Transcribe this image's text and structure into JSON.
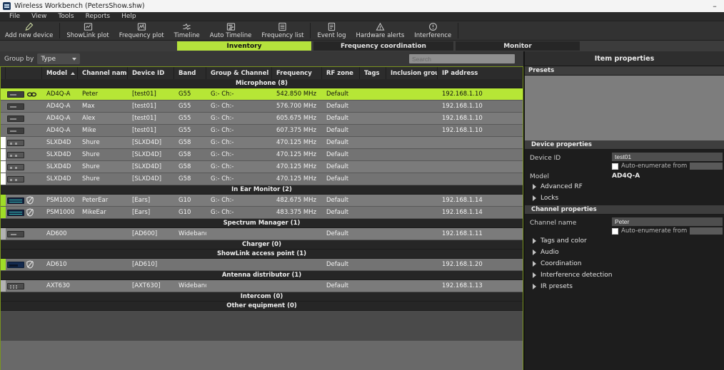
{
  "window": {
    "title": "Wireless Workbench (PetersShow.shw)",
    "minimize_glyph": "–"
  },
  "menu": {
    "items": [
      "File",
      "View",
      "Tools",
      "Reports",
      "Help"
    ]
  },
  "toolbar": {
    "group1": [
      {
        "label": "Add new device",
        "icon": "microphone-pencil-icon"
      }
    ],
    "group2": [
      {
        "label": "ShowLink plot",
        "icon": "showlink-plot-icon"
      },
      {
        "label": "Frequency plot",
        "icon": "frequency-plot-icon"
      },
      {
        "label": "Timeline",
        "icon": "timeline-icon"
      },
      {
        "label": "Auto Timeline",
        "icon": "auto-timeline-icon"
      },
      {
        "label": "Frequency list",
        "icon": "frequency-list-icon"
      }
    ],
    "group3": [
      {
        "label": "Event log",
        "icon": "event-log-icon"
      },
      {
        "label": "Hardware alerts",
        "icon": "warning-triangle-icon"
      },
      {
        "label": "Interference",
        "icon": "interference-circle-icon"
      }
    ]
  },
  "tabs": {
    "inventory": "Inventory",
    "frequency_coordination": "Frequency coordination",
    "monitor": "Monitor"
  },
  "filter": {
    "group_by_label": "Group by",
    "group_by_value": "Type",
    "search_placeholder": "Search"
  },
  "table": {
    "headers": {
      "model": "Model",
      "channel": "Channel name",
      "device_id": "Device ID",
      "band": "Band",
      "group_channel": "Group & Channel",
      "frequency": "Frequency",
      "rf_zone": "RF zone",
      "tags": "Tags",
      "inclusion": "Inclusion group",
      "ip": "IP address"
    },
    "rows": [
      {
        "type": "group",
        "label": "Microphone (8)"
      },
      {
        "type": "device",
        "selected": true,
        "indicator": "none",
        "kind": "ad4q",
        "badge": "link",
        "model": "AD4Q-A",
        "channel": "Peter",
        "device_id": "[test01]",
        "band": "G55",
        "group_channel": "G:- Ch:-",
        "frequency": "542.850 MHz",
        "rf_zone": "Default",
        "tags": "",
        "inclusion": "",
        "ip": "192.168.1.10"
      },
      {
        "type": "device",
        "indicator": "none",
        "kind": "ad4q",
        "badge": "",
        "model": "AD4Q-A",
        "channel": "Max",
        "device_id": "[test01]",
        "band": "G55",
        "group_channel": "G:- Ch:-",
        "frequency": "576.700 MHz",
        "rf_zone": "Default",
        "tags": "",
        "inclusion": "",
        "ip": "192.168.1.10"
      },
      {
        "type": "device",
        "indicator": "none",
        "kind": "ad4q",
        "badge": "",
        "model": "AD4Q-A",
        "channel": "Alex",
        "device_id": "[test01]",
        "band": "G55",
        "group_channel": "G:- Ch:-",
        "frequency": "605.675 MHz",
        "rf_zone": "Default",
        "tags": "",
        "inclusion": "",
        "ip": "192.168.1.10"
      },
      {
        "type": "device",
        "indicator": "none",
        "kind": "ad4q",
        "badge": "",
        "model": "AD4Q-A",
        "channel": "Mike",
        "device_id": "[test01]",
        "band": "G55",
        "group_channel": "G:- Ch:-",
        "frequency": "607.375 MHz",
        "rf_zone": "Default",
        "tags": "",
        "inclusion": "",
        "ip": "192.168.1.10"
      },
      {
        "type": "device",
        "indicator": "white",
        "kind": "slxd",
        "badge": "",
        "model": "SLXD4D",
        "channel": "Shure",
        "device_id": "[SLXD4D]",
        "band": "G58",
        "group_channel": "G:- Ch:-",
        "frequency": "470.125 MHz",
        "rf_zone": "Default",
        "tags": "",
        "inclusion": "",
        "ip": ""
      },
      {
        "type": "device",
        "indicator": "white",
        "kind": "slxd",
        "badge": "",
        "model": "SLXD4D",
        "channel": "Shure",
        "device_id": "[SLXD4D]",
        "band": "G58",
        "group_channel": "G:- Ch:-",
        "frequency": "470.125 MHz",
        "rf_zone": "Default",
        "tags": "",
        "inclusion": "",
        "ip": ""
      },
      {
        "type": "device",
        "indicator": "white",
        "kind": "slxd",
        "badge": "",
        "model": "SLXD4D",
        "channel": "Shure",
        "device_id": "[SLXD4D]",
        "band": "G58",
        "group_channel": "G:- Ch:-",
        "frequency": "470.125 MHz",
        "rf_zone": "Default",
        "tags": "",
        "inclusion": "",
        "ip": ""
      },
      {
        "type": "device",
        "indicator": "white",
        "kind": "slxd",
        "badge": "",
        "model": "SLXD4D",
        "channel": "Shure",
        "device_id": "[SLXD4D]",
        "band": "G58",
        "group_channel": "G:- Ch:-",
        "frequency": "470.125 MHz",
        "rf_zone": "Default",
        "tags": "",
        "inclusion": "",
        "ip": ""
      },
      {
        "type": "group",
        "label": "In Ear Monitor (2)"
      },
      {
        "type": "device",
        "indicator": "green",
        "kind": "psm",
        "badge": "shield",
        "model": "PSM1000",
        "channel": "PeterEar",
        "device_id": "[Ears]",
        "band": "G10",
        "group_channel": "G:- Ch:-",
        "frequency": "482.675 MHz",
        "rf_zone": "Default",
        "tags": "",
        "inclusion": "",
        "ip": "192.168.1.14"
      },
      {
        "type": "device",
        "indicator": "green",
        "kind": "psm",
        "badge": "shield",
        "model": "PSM1000",
        "channel": "MikeEar",
        "device_id": "[Ears]",
        "band": "G10",
        "group_channel": "G:- Ch:-",
        "frequency": "483.375 MHz",
        "rf_zone": "Default",
        "tags": "",
        "inclusion": "",
        "ip": "192.168.1.14"
      },
      {
        "type": "group",
        "label": "Spectrum Manager (1)"
      },
      {
        "type": "device",
        "indicator": "light",
        "kind": "ad600",
        "badge": "",
        "model": "AD600",
        "channel": "",
        "device_id": "[AD600]",
        "band": "Wideband",
        "group_channel": "",
        "frequency": "",
        "rf_zone": "Default",
        "tags": "",
        "inclusion": "",
        "ip": "192.168.1.11"
      },
      {
        "type": "group",
        "label": "Charger (0)"
      },
      {
        "type": "group",
        "label": "ShowLink access point (1)"
      },
      {
        "type": "device",
        "indicator": "green",
        "kind": "ad610",
        "badge": "shield",
        "model": "AD610",
        "channel": "",
        "device_id": "[AD610]",
        "band": "",
        "group_channel": "",
        "frequency": "",
        "rf_zone": "Default",
        "tags": "",
        "inclusion": "",
        "ip": "192.168.1.20"
      },
      {
        "type": "group",
        "label": "Antenna distributor (1)"
      },
      {
        "type": "device",
        "indicator": "light",
        "kind": "axt",
        "badge": "",
        "model": "AXT630",
        "channel": "",
        "device_id": "[AXT630]",
        "band": "Wideband",
        "group_channel": "",
        "frequency": "",
        "rf_zone": "Default",
        "tags": "",
        "inclusion": "",
        "ip": "192.168.1.13"
      },
      {
        "type": "group",
        "label": "Intercom (0)"
      },
      {
        "type": "group",
        "label": "Other equipment (0)"
      }
    ]
  },
  "panel": {
    "title": "Item properties",
    "presets_title": "Presets",
    "device_properties": {
      "title": "Device properties",
      "device_id_label": "Device ID",
      "device_id_value": "test01",
      "auto_enumerate_label": "Auto-enumerate from",
      "model_label": "Model",
      "model_value": "AD4Q-A",
      "collapsed": {
        "0": "Advanced RF",
        "1": "Locks"
      }
    },
    "channel_properties": {
      "title": "Channel properties",
      "channel_name_label": "Channel name",
      "channel_name_value": "Peter",
      "auto_enumerate_label": "Auto-enumerate from",
      "collapsed": {
        "0": "Tags and color",
        "1": "Audio",
        "2": "Coordination",
        "3": "Interference detection",
        "4": "IR presets"
      }
    }
  },
  "colors": {
    "accent_green": "#b5e23c",
    "selected_row": "#b6e636",
    "indicator_green": "#9fdc28"
  }
}
